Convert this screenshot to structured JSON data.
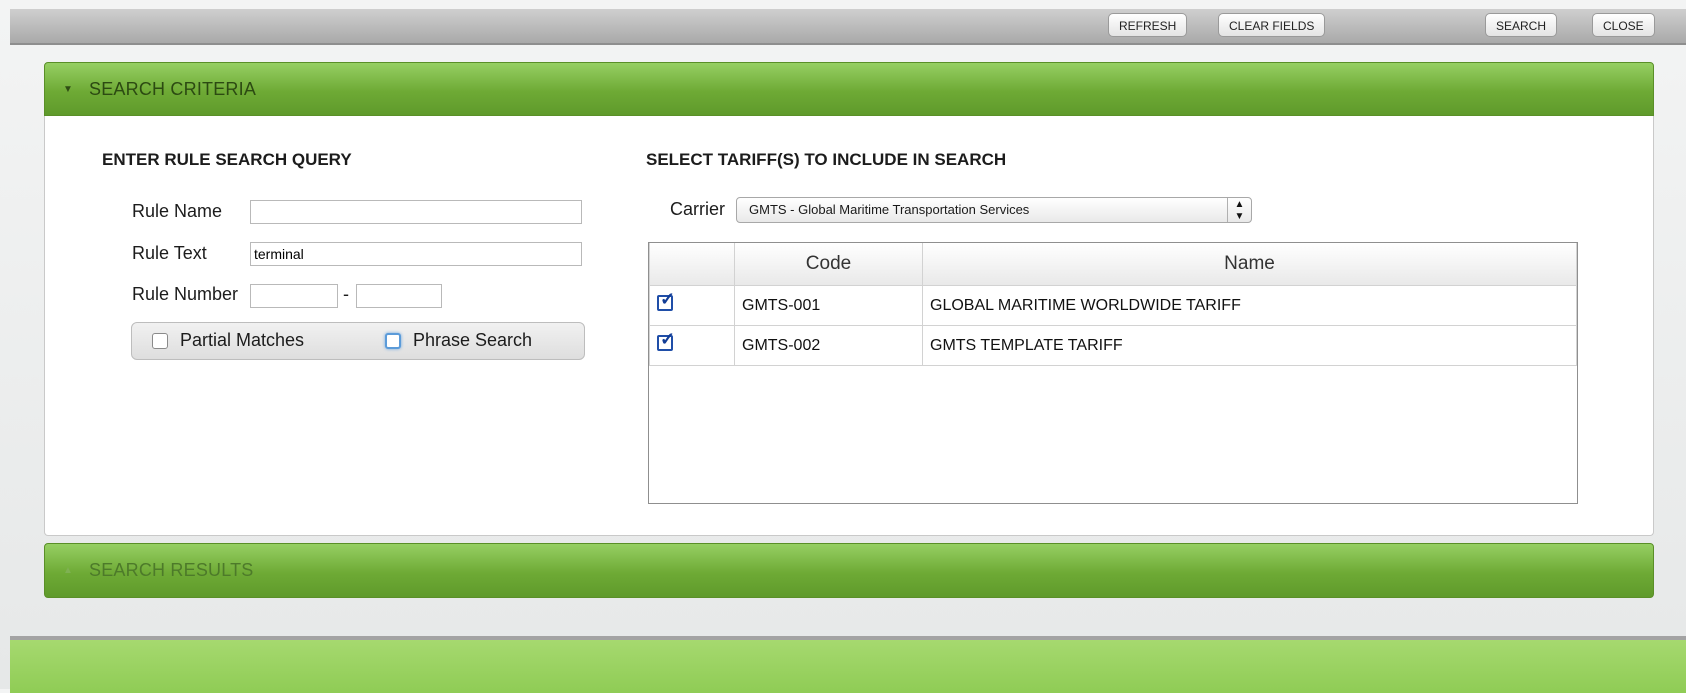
{
  "toolbar": {
    "refresh": "REFRESH",
    "clear_fields": "CLEAR FIELDS",
    "search": "SEARCH",
    "close": "CLOSE"
  },
  "criteria_panel": {
    "title": "SEARCH CRITERIA",
    "caret": "▼"
  },
  "query": {
    "title": "ENTER RULE SEARCH QUERY",
    "rule_name_label": "Rule Name",
    "rule_name_value": "",
    "rule_text_label": "Rule Text",
    "rule_text_value": "terminal",
    "rule_number_label": "Rule Number",
    "rule_number_from": "",
    "rule_number_sep": "-",
    "rule_number_to": "",
    "partial_matches_label": "Partial Matches",
    "partial_matches_checked": false,
    "phrase_search_label": "Phrase Search",
    "phrase_search_checked": false
  },
  "tariffs": {
    "title": "SELECT TARIFF(S) TO INCLUDE IN SEARCH",
    "carrier_label": "Carrier",
    "carrier_value": "GMTS - Global Maritime Transportation Services",
    "columns": [
      "",
      "Code",
      "Name"
    ],
    "rows": [
      {
        "checked": true,
        "code": "GMTS-001",
        "name": "GLOBAL MARITIME WORLDWIDE TARIFF"
      },
      {
        "checked": true,
        "code": "GMTS-002",
        "name": "GMTS TEMPLATE TARIFF"
      }
    ]
  },
  "results_panel": {
    "title": "SEARCH RESULTS",
    "caret": "▲"
  },
  "colors": {
    "header_green": "#6eaa35",
    "footer_green": "#96d15f",
    "toolbar_gray": "#bdbdbd"
  }
}
